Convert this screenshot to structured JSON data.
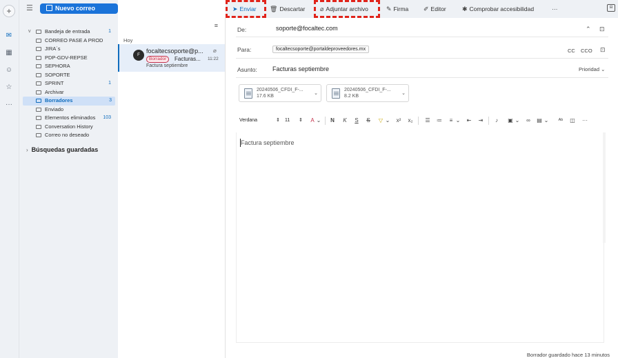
{
  "rail": {
    "icons": [
      "plus-icon",
      "mail-icon",
      "calendar-icon",
      "people-icon",
      "favorites-icon",
      "more-icon"
    ]
  },
  "sidebar": {
    "new_mail_label": "Nuevo correo",
    "folders": [
      {
        "label": "Bandeja de entrada",
        "count": "1",
        "expand": "v",
        "icon": "inbox-icon"
      },
      {
        "label": "CORREO PASE A PROD",
        "count": "",
        "expand": "",
        "icon": "folder-icon"
      },
      {
        "label": "JIRA´s",
        "count": "",
        "expand": "",
        "icon": "folder-icon"
      },
      {
        "label": "PDP-GDV-REPSE",
        "count": "",
        "expand": "",
        "icon": "folder-icon"
      },
      {
        "label": "SEPHORA",
        "count": "",
        "expand": "",
        "icon": "folder-icon"
      },
      {
        "label": "SOPORTE",
        "count": "",
        "expand": "",
        "icon": "folder-icon"
      },
      {
        "label": "SPRINT",
        "count": "1",
        "expand": "",
        "icon": "folder-icon"
      },
      {
        "label": "Archivar",
        "count": "",
        "expand": "",
        "icon": "archive-icon"
      },
      {
        "label": "Borradores",
        "count": "3",
        "expand": "",
        "icon": "pencil-icon",
        "selected": true
      },
      {
        "label": "Enviado",
        "count": "",
        "expand": "",
        "icon": "send-icon"
      },
      {
        "label": "Elementos eliminados",
        "count": "103",
        "expand": "",
        "icon": "trash-icon"
      },
      {
        "label": "Conversation History",
        "count": "",
        "expand": "",
        "icon": "folder-icon"
      },
      {
        "label": "Correo no deseado",
        "count": "",
        "expand": "",
        "icon": "junk-icon"
      }
    ],
    "saved_searches": "Búsquedas guardadas"
  },
  "message_list": {
    "group": "Hoy",
    "item": {
      "avatar": "F",
      "sender": "focaltecsoporte@p...",
      "badge": "Borrador",
      "subject": "Facturas...",
      "time": "11:22",
      "preview": "Factura septiembre"
    }
  },
  "toolbar": {
    "send": "Enviar",
    "discard": "Descartar",
    "attach": "Adjuntar archivo",
    "signature": "Firma",
    "editor": "Editor",
    "accessibility": "Comprobar accesibilidad",
    "more": "···"
  },
  "compose": {
    "from_label": "De:",
    "from_value": "soporte@focaltec.com",
    "to_label": "Para:",
    "to_value": "focaltecsoporte@portaldeproveedores.mx",
    "cc": "CC",
    "cco": "CCO",
    "subject_label": "Asunto:",
    "subject_value": "Facturas septiembre",
    "priority": "Prioridad",
    "attachments": [
      {
        "name": "20240506_CFDI_F-...",
        "size": "17.6 KB"
      },
      {
        "name": "20240506_CFDI_F-...",
        "size": "8.2 KB"
      }
    ],
    "font": "Verdana",
    "font_size": "11",
    "body": "Factura septiembre",
    "status": "Borrador guardado hace 13 minutos"
  },
  "colors": {
    "accent": "#0f6cbd",
    "new_mail_bg": "#1a73d9",
    "highlight": "#e0231a",
    "draft_badge": "#c4314b"
  }
}
